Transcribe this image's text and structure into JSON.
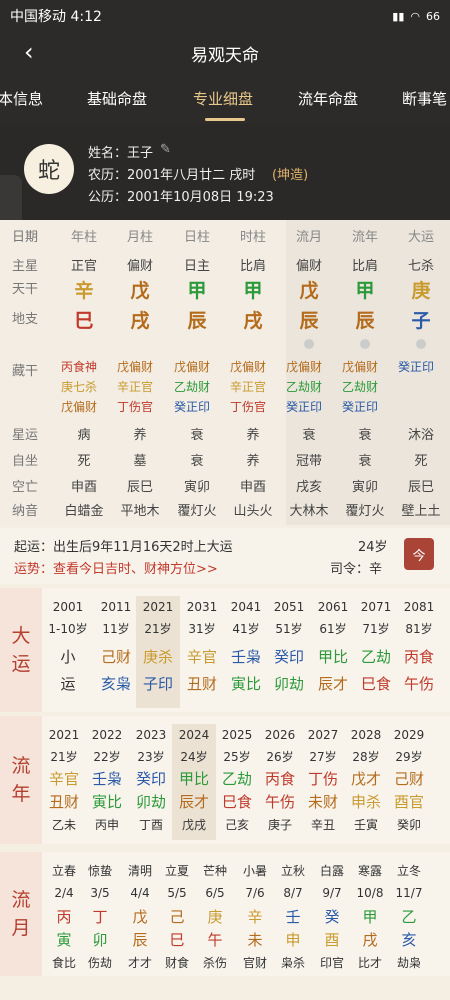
{
  "status": {
    "carrier_time": "中国移动 4:12",
    "battery": "66"
  },
  "nav": {
    "title": "易观天命"
  },
  "tabs": [
    "本信息",
    "基础命盘",
    "专业细盘",
    "流年命盘",
    "断事笔"
  ],
  "profile": {
    "avatar": "蛇",
    "name": "姓名：王子",
    "lunar": "农历：2001年八月廿二 戌时",
    "lunar_tag": "(坤造)",
    "solar": "公历：2001年10月08日 19:23"
  },
  "grid": {
    "headers": [
      "日期",
      "年柱",
      "月柱",
      "日柱",
      "时柱",
      "流月",
      "流年",
      "大运"
    ],
    "rows": [
      "主星",
      "天干",
      "地支",
      "藏干",
      "星运",
      "自坐",
      "空亡",
      "纳音"
    ],
    "stars": [
      "正官",
      "偏财",
      "日主",
      "比肩",
      "偏财",
      "比肩",
      "七杀"
    ],
    "gan": [
      "辛",
      "戊",
      "甲",
      "甲",
      "戊",
      "甲",
      "庚"
    ],
    "zhi": [
      "巳",
      "戌",
      "辰",
      "戌",
      "辰",
      "辰",
      "子"
    ],
    "cang": [
      [
        "丙食神",
        "庚七杀",
        "戊偏财"
      ],
      [
        "戊偏财",
        "辛正官",
        "丁伤官"
      ],
      [
        "戊偏财",
        "乙劫财",
        "癸正印"
      ],
      [
        "戊偏财",
        "辛正官",
        "丁伤官"
      ],
      [
        "戊偏财",
        "乙劫财",
        "癸正印"
      ],
      [
        "戊偏财",
        "乙劫财",
        "癸正印"
      ],
      [
        "癸正印"
      ]
    ],
    "xingyun": [
      "病",
      "养",
      "衰",
      "养",
      "衰",
      "衰",
      "沐浴"
    ],
    "zizuo": [
      "死",
      "墓",
      "衰",
      "养",
      "冠带",
      "衰",
      "死"
    ],
    "kongwang": [
      "申酉",
      "辰巳",
      "寅卯",
      "申酉",
      "戌亥",
      "寅卯",
      "辰巳"
    ],
    "nayin": [
      "白蜡金",
      "平地木",
      "覆灯火",
      "山头火",
      "大林木",
      "覆灯火",
      "壁上土"
    ]
  },
  "start": {
    "text1": "起运：出生后9年11月16天2时上大运",
    "age": "24岁",
    "text2": "运势：查看今日吉时、财神方位>>",
    "siling": "司令：辛",
    "cal": "今"
  },
  "dayun": {
    "label": "大运",
    "years": [
      "2001",
      "2011",
      "2021",
      "2031",
      "2041",
      "2051",
      "2061",
      "2071",
      "2081"
    ],
    "ages": [
      "1-10岁",
      "11岁",
      "21岁",
      "31岁",
      "41岁",
      "51岁",
      "61岁",
      "71岁",
      "81岁"
    ],
    "gan": [
      "小",
      "己财",
      "庚杀",
      "辛官",
      "壬枭",
      "癸印",
      "甲比",
      "乙劫",
      "丙食"
    ],
    "zhi": [
      "运",
      "亥枭",
      "子印",
      "丑财",
      "寅比",
      "卯劫",
      "辰才",
      "巳食",
      "午伤"
    ]
  },
  "liunian": {
    "label": "流年",
    "years": [
      "2021",
      "2022",
      "2023",
      "2024",
      "2025",
      "2026",
      "2027",
      "2028",
      "2029"
    ],
    "ages": [
      "21岁",
      "22岁",
      "23岁",
      "24岁",
      "25岁",
      "26岁",
      "27岁",
      "28岁",
      "29岁"
    ],
    "gan": [
      "辛官",
      "壬枭",
      "癸印",
      "甲比",
      "乙劫",
      "丙食",
      "丁伤",
      "戊才",
      "己财"
    ],
    "zhi": [
      "丑财",
      "寅比",
      "卯劫",
      "辰才",
      "巳食",
      "午伤",
      "未财",
      "申杀",
      "酉官"
    ],
    "gz": [
      "乙未",
      "丙申",
      "丁酉",
      "戊戌",
      "己亥",
      "庚子",
      "辛丑",
      "壬寅",
      "癸卯"
    ]
  },
  "liuyue": {
    "label": "流月",
    "terms": [
      "立春",
      "惊蛰",
      "清明",
      "立夏",
      "芒种",
      "小暑",
      "立秋",
      "白露",
      "寒露",
      "立冬"
    ],
    "dates": [
      "2/4",
      "3/5",
      "4/4",
      "5/5",
      "6/5",
      "7/6",
      "8/7",
      "9/7",
      "10/8",
      "11/7"
    ],
    "gan": [
      "丙",
      "丁",
      "戊",
      "己",
      "庚",
      "辛",
      "壬",
      "癸",
      "甲",
      "乙"
    ],
    "zhi": [
      "寅",
      "卯",
      "辰",
      "巳",
      "午",
      "未",
      "申",
      "酉",
      "戌",
      "亥"
    ],
    "shen": [
      "食比",
      "伤劫",
      "才才",
      "财食",
      "杀伤",
      "官财",
      "枭杀",
      "印官",
      "比才",
      "劫枭"
    ]
  }
}
